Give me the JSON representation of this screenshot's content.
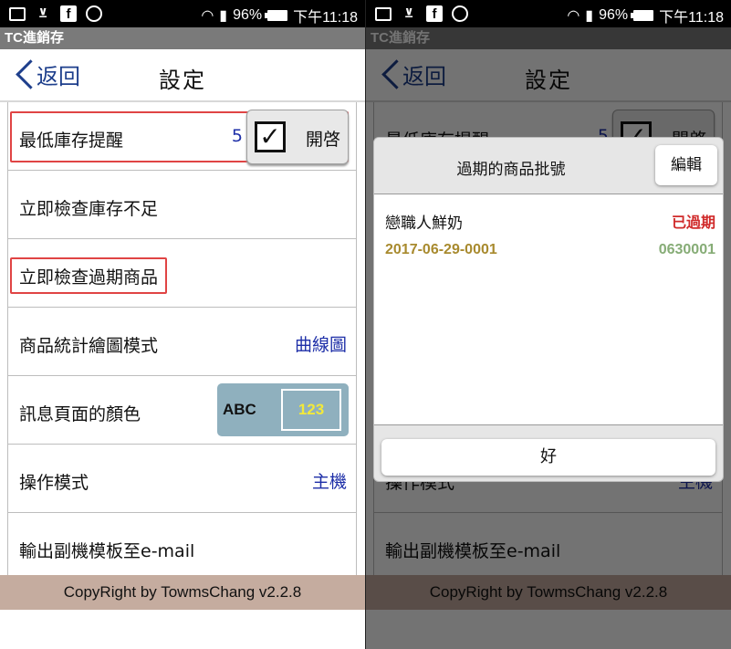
{
  "statusbar": {
    "battery": "96%",
    "time": "下午11:18",
    "fb_glyph": "f",
    "check_glyph": "⊻"
  },
  "app": {
    "title": "TC進銷存"
  },
  "nav": {
    "back_label": "返回",
    "title": "設定"
  },
  "settings": {
    "rows": [
      {
        "label": "最低庫存提醒",
        "value": "5",
        "toggle_label": "開啓",
        "checked": "✓"
      },
      {
        "label": "立即檢查庫存不足"
      },
      {
        "label": "立即檢查過期商品"
      },
      {
        "label": "商品統計繪圖模式",
        "value": "曲線圖"
      },
      {
        "label": "訊息頁面的顏色",
        "sample_text": "ABC",
        "sample_number": "123"
      },
      {
        "label": "操作模式",
        "value": "主機"
      },
      {
        "label": "輸出副機模板至e-mail"
      }
    ]
  },
  "footer": {
    "text": "CopyRight by TowmsChang  v2.2.8"
  },
  "dialog": {
    "title": "過期的商品批號",
    "edit_label": "編輯",
    "items": [
      {
        "name": "戀職人鮮奶",
        "status": "已過期",
        "lot": "2017-06-29-0001",
        "code": "0630001"
      }
    ],
    "ok_label": "好"
  },
  "colors": {
    "accent": "#1e2fa8",
    "highlight": "#e04444",
    "footer_bg": "#c5ac9f",
    "expired": "#d02a2a",
    "lot": "#a88a2e",
    "code": "#86ac76"
  }
}
